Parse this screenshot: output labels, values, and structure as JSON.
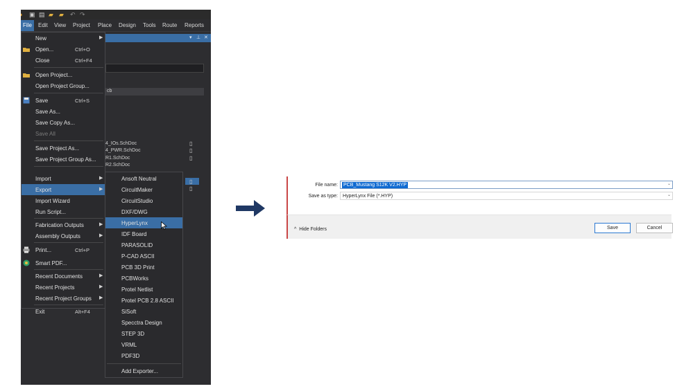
{
  "menubar": {
    "items": [
      "File",
      "Edit",
      "View",
      "Project",
      "Place",
      "Design",
      "Tools",
      "Route",
      "Reports"
    ]
  },
  "file_menu": {
    "items": [
      {
        "label": "New",
        "shortcut": "",
        "submenu": true
      },
      {
        "label": "Open...",
        "shortcut": "Ctrl+O",
        "submenu": false
      },
      {
        "label": "Close",
        "shortcut": "Ctrl+F4",
        "submenu": false
      },
      {
        "label": "Open Project...",
        "shortcut": "",
        "submenu": false
      },
      {
        "label": "Open Project Group...",
        "shortcut": "",
        "submenu": false
      },
      {
        "label": "Save",
        "shortcut": "Ctrl+S",
        "submenu": false
      },
      {
        "label": "Save As...",
        "shortcut": "",
        "submenu": false
      },
      {
        "label": "Save Copy As...",
        "shortcut": "",
        "submenu": false
      },
      {
        "label": "Save All",
        "shortcut": "",
        "submenu": false,
        "disabled": true
      },
      {
        "label": "Save Project As...",
        "shortcut": "",
        "submenu": false
      },
      {
        "label": "Save Project Group As...",
        "shortcut": "",
        "submenu": false
      },
      {
        "label": "Import",
        "shortcut": "",
        "submenu": true
      },
      {
        "label": "Export",
        "shortcut": "",
        "submenu": true,
        "selected": true
      },
      {
        "label": "Import Wizard",
        "shortcut": "",
        "submenu": false
      },
      {
        "label": "Run Script...",
        "shortcut": "",
        "submenu": false
      },
      {
        "label": "Fabrication Outputs",
        "shortcut": "",
        "submenu": true
      },
      {
        "label": "Assembly Outputs",
        "shortcut": "",
        "submenu": true
      },
      {
        "label": "Print...",
        "shortcut": "Ctrl+P",
        "submenu": false
      },
      {
        "label": "Smart PDF...",
        "shortcut": "",
        "submenu": false
      },
      {
        "label": "Recent Documents",
        "shortcut": "",
        "submenu": true
      },
      {
        "label": "Recent Projects",
        "shortcut": "",
        "submenu": true
      },
      {
        "label": "Recent Project Groups",
        "shortcut": "",
        "submenu": true
      },
      {
        "label": "Exit",
        "shortcut": "Alt+F4",
        "submenu": false
      }
    ]
  },
  "export_menu": {
    "items": [
      {
        "label": "Ansoft Neutral"
      },
      {
        "label": "CircuitMaker"
      },
      {
        "label": "CircuitStudio"
      },
      {
        "label": "DXF/DWG"
      },
      {
        "label": "HyperLynx",
        "selected": true
      },
      {
        "label": "IDF Board"
      },
      {
        "label": "PARASOLID"
      },
      {
        "label": "P-CAD ASCII"
      },
      {
        "label": "PCB 3D Print"
      },
      {
        "label": "PCBWorks"
      },
      {
        "label": "Protel Netlist"
      },
      {
        "label": "Protel PCB 2.8 ASCII"
      },
      {
        "label": "SiSoft"
      },
      {
        "label": "Specctra Design"
      },
      {
        "label": "STEP 3D"
      },
      {
        "label": "VRML"
      },
      {
        "label": "PDF3D"
      },
      {
        "label": "Add Exporter..."
      }
    ]
  },
  "background_panel": {
    "project_label": "cb",
    "files": [
      "4_IOs.SchDoc",
      "4_PWR.SchDoc",
      "R1.SchDoc",
      "R2.SchDoc"
    ]
  },
  "save_dialog": {
    "filename_label": "File name:",
    "filename_value": "PCB_Mustang S12K V2.HYP",
    "save_as_type_label": "Save as type:",
    "save_as_type_value": "HyperLynx File (*.HYP)",
    "hide_folders_label": "Hide Folders",
    "save_button": "Save",
    "cancel_button": "Cancel"
  },
  "colors": {
    "ide_background": "#2d2d30",
    "highlight": "#3a6ea5",
    "arrow": "#1f3864",
    "selection": "#0f6ad1"
  }
}
